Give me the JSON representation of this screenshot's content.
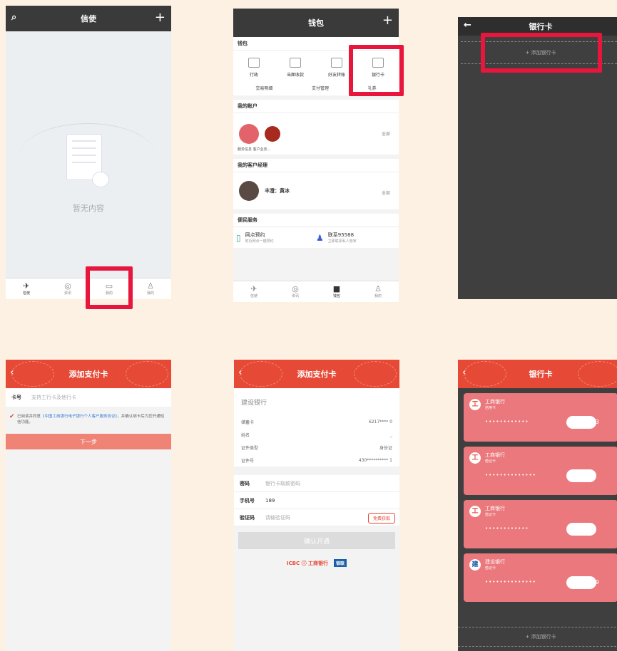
{
  "p1": {
    "title": "信使",
    "empty_text": "暂无内容",
    "tabs": [
      {
        "label": "信使",
        "icon": "send-icon"
      },
      {
        "label": "资讯",
        "icon": "compass-icon"
      },
      {
        "label": "我的",
        "icon": "wallet-icon"
      },
      {
        "label": "我的",
        "icon": "person-icon"
      }
    ]
  },
  "p2": {
    "title": "钱包",
    "sec1": "钱包",
    "grid": [
      "行政",
      "当面收款",
      "好友转账",
      "银行卡"
    ],
    "row3": [
      "交易明细",
      "支付管理",
      "礼券"
    ],
    "sec2": "我的账户",
    "acct_cap": "服务信息  客户业务...",
    "more": "全部",
    "sec3": "我的客户经理",
    "manager": "丰澄：黄冰",
    "sec4": "便民服务",
    "svc1": "网点预约",
    "svc1_sub": "附近网点一键预约",
    "svc2": "联系95588",
    "svc2_sub": "立即联系私人管家",
    "tabs": [
      "信使",
      "资讯",
      "钱包",
      "我的"
    ]
  },
  "p3": {
    "title": "银行卡",
    "add": "+ 添加银行卡"
  },
  "p4": {
    "title": "添加支付卡",
    "card_label": "卡号",
    "card_ph": "支持工行卡及他行卡",
    "agree_pre": "已阅读并同意",
    "agree_link": "《中国工商银行电子银行个人客户服务协议》",
    "agree_post": "，并确认绑卡后为您开通短信功能。",
    "next": "下一步"
  },
  "p5": {
    "title": "添加支付卡",
    "bank": "建设银行",
    "rows": [
      {
        "k": "储蓄卡",
        "v": "6217****  0"
      },
      {
        "k": "姓名",
        "v": "_"
      },
      {
        "k": "证件类型",
        "v": "身份证"
      },
      {
        "k": "证件号",
        "v": "430**********  1"
      }
    ],
    "pwd_label": "密码",
    "pwd_ph": "银行卡取款密码",
    "phone_label": "手机号",
    "phone_val": "189",
    "code_label": "验证码",
    "code_ph": "请输验证码",
    "sms_btn": "免费获取",
    "confirm": "确认开通",
    "logo_icbc": "ICBC ⓘ 工商银行",
    "logo_up": "银联"
  },
  "p6": {
    "title": "银行卡",
    "cards": [
      {
        "logo": "工",
        "name": "工商银行",
        "type": "信用卡",
        "num": "••••••••••••",
        "tail": "3"
      },
      {
        "logo": "工",
        "name": "工商银行",
        "type": "借记卡",
        "num": "••••••••••••••",
        "tail": ""
      },
      {
        "logo": "工",
        "name": "工商银行",
        "type": "借记卡",
        "num": "••••••••••••",
        "tail": ""
      },
      {
        "logo": "建",
        "name": "建设银行",
        "type": "借记卡",
        "num": "••••••••••••••",
        "tail": "9"
      }
    ],
    "add": "+ 添加银行卡"
  },
  "colors": {
    "highlight": "#e8153d",
    "red": "#e64a36",
    "card": "#ea787c"
  }
}
